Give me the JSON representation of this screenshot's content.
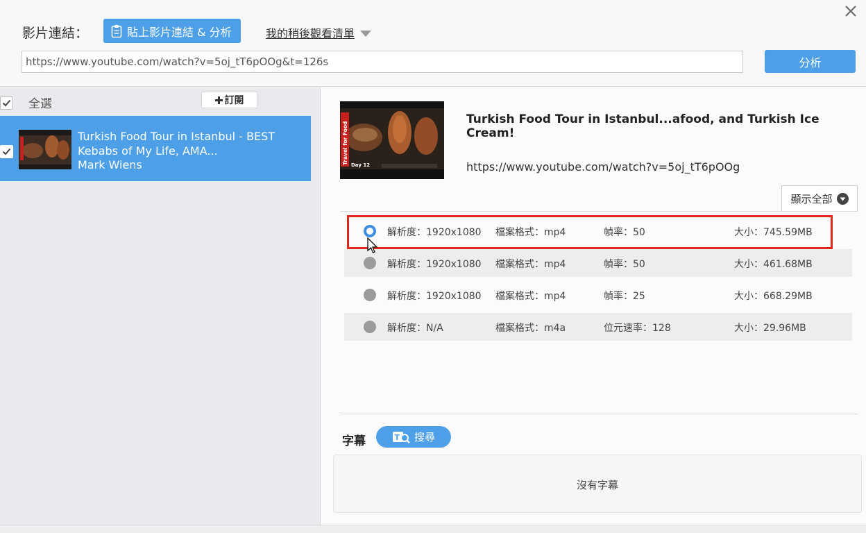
{
  "header": {
    "video_link_label": "影片連結：",
    "paste_button": "貼上影片連結 & 分析",
    "watch_later": "我的稍後觀看清單",
    "url_value": "https://www.youtube.com/watch?v=5oj_tT6pOOg&t=126s",
    "analyze_button": "分析"
  },
  "left_panel": {
    "select_all": "全選",
    "subscribe_button": "訂閱",
    "items": [
      {
        "title": "Turkish Food Tour in Istanbul - BEST Kebabs of My Life, AMA...",
        "author": "Mark Wiens"
      }
    ]
  },
  "detail": {
    "title": "Turkish Food Tour in Istanbul...afood, and Turkish Ice Cream!",
    "url": "https://www.youtube.com/watch?v=5oj_tT6pOOg",
    "show_all": "顯示全部",
    "thumb_caption_side": "Travel for Food",
    "thumb_caption_day": "Day 12",
    "formats": [
      {
        "res": "解析度：1920x1080",
        "fmt": "檔案格式：mp4",
        "rate": "幀率：50",
        "size": "大小：745.59MB",
        "selected": true
      },
      {
        "res": "解析度：1920x1080",
        "fmt": "檔案格式：mp4",
        "rate": "幀率：50",
        "size": "大小：461.68MB",
        "selected": false
      },
      {
        "res": "解析度：1920x1080",
        "fmt": "檔案格式：mp4",
        "rate": "幀率：25",
        "size": "大小：668.29MB",
        "selected": false
      },
      {
        "res": "解析度：N/A",
        "fmt": "檔案格式：m4a",
        "rate": "位元速率：128",
        "size": "大小：29.96MB",
        "selected": false
      }
    ]
  },
  "subtitles": {
    "label": "字幕",
    "search_button": "搜尋",
    "empty": "沒有字幕"
  },
  "colors": {
    "accent": "#4d9fe8",
    "highlight": "#e0281f"
  }
}
